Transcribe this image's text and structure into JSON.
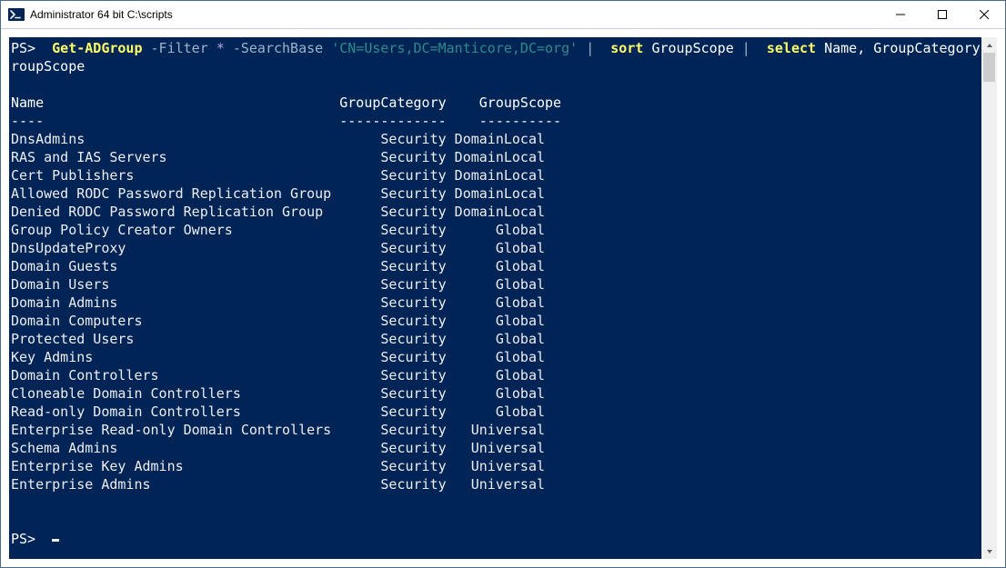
{
  "window": {
    "title": "Administrator 64 bit C:\\scripts"
  },
  "cmd": {
    "prompt": "PS>",
    "get_adgroup": "Get-ADGroup",
    "filter_param": "-Filter",
    "filter_arg": "*",
    "searchbase_param": "-SearchBase",
    "searchbase_arg": "'CN=Users,DC=Manticore,DC=org'",
    "pipe": "|",
    "sort": "sort",
    "sort_arg": "GroupScope",
    "select": "select",
    "select_args": "Name, GroupCategory, G",
    "wrap_tail": "roupScope"
  },
  "headers": {
    "name": "Name",
    "category": "GroupCategory",
    "scope": "GroupScope",
    "rule_name": "----",
    "rule_category": "-------------",
    "rule_scope": "----------"
  },
  "rows": [
    {
      "name": "DnsAdmins",
      "category": "Security",
      "scope": "DomainLocal"
    },
    {
      "name": "RAS and IAS Servers",
      "category": "Security",
      "scope": "DomainLocal"
    },
    {
      "name": "Cert Publishers",
      "category": "Security",
      "scope": "DomainLocal"
    },
    {
      "name": "Allowed RODC Password Replication Group",
      "category": "Security",
      "scope": "DomainLocal"
    },
    {
      "name": "Denied RODC Password Replication Group",
      "category": "Security",
      "scope": "DomainLocal"
    },
    {
      "name": "Group Policy Creator Owners",
      "category": "Security",
      "scope": "Global"
    },
    {
      "name": "DnsUpdateProxy",
      "category": "Security",
      "scope": "Global"
    },
    {
      "name": "Domain Guests",
      "category": "Security",
      "scope": "Global"
    },
    {
      "name": "Domain Users",
      "category": "Security",
      "scope": "Global"
    },
    {
      "name": "Domain Admins",
      "category": "Security",
      "scope": "Global"
    },
    {
      "name": "Domain Computers",
      "category": "Security",
      "scope": "Global"
    },
    {
      "name": "Protected Users",
      "category": "Security",
      "scope": "Global"
    },
    {
      "name": "Key Admins",
      "category": "Security",
      "scope": "Global"
    },
    {
      "name": "Domain Controllers",
      "category": "Security",
      "scope": "Global"
    },
    {
      "name": "Cloneable Domain Controllers",
      "category": "Security",
      "scope": "Global"
    },
    {
      "name": "Read-only Domain Controllers",
      "category": "Security",
      "scope": "Global"
    },
    {
      "name": "Enterprise Read-only Domain Controllers",
      "category": "Security",
      "scope": "Universal"
    },
    {
      "name": "Schema Admins",
      "category": "Security",
      "scope": "Universal"
    },
    {
      "name": "Enterprise Key Admins",
      "category": "Security",
      "scope": "Universal"
    },
    {
      "name": "Enterprise Admins",
      "category": "Security",
      "scope": "Universal"
    }
  ],
  "col_widths": {
    "name": 40,
    "category": 13,
    "scope": 11
  }
}
